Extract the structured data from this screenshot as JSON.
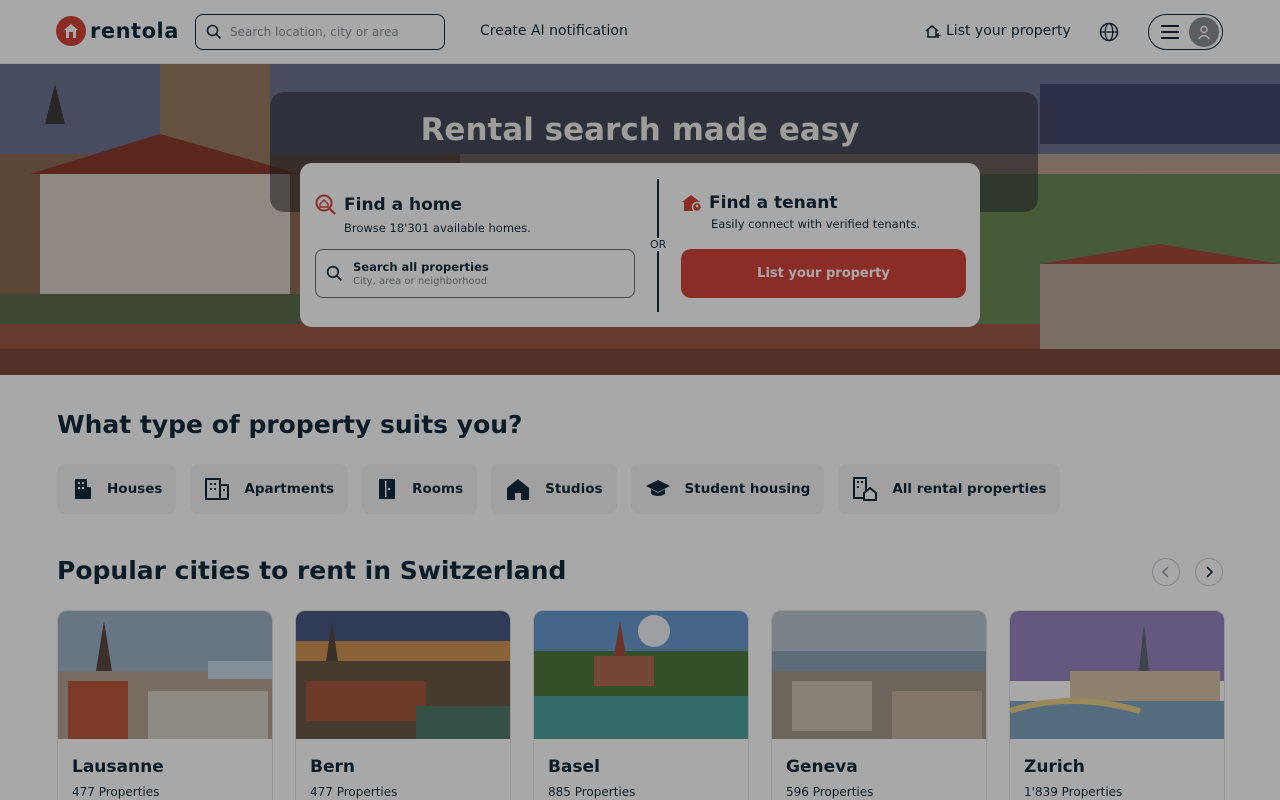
{
  "header": {
    "logo_text": "rentola",
    "search_placeholder": "Search location, city or area",
    "create_ai_label": "Create AI notification",
    "list_property_label": "List your property"
  },
  "hero": {
    "title": "Rental search made easy",
    "find_home": {
      "title": "Find a home",
      "subtitle": "Browse 18'301 available homes.",
      "search_title": "Search all properties",
      "search_subtitle": "City, area or neighborhood"
    },
    "or_label": "OR",
    "find_tenant": {
      "title": "Find a tenant",
      "subtitle": "Easily connect with verified tenants.",
      "button_label": "List your property"
    }
  },
  "property_types": {
    "title": "What type of property suits you?",
    "items": [
      {
        "label": "Houses",
        "icon": "building-icon"
      },
      {
        "label": "Apartments",
        "icon": "apartment-icon"
      },
      {
        "label": "Rooms",
        "icon": "door-icon"
      },
      {
        "label": "Studios",
        "icon": "home-icon"
      },
      {
        "label": "Student housing",
        "icon": "graduation-cap-icon"
      },
      {
        "label": "All rental properties",
        "icon": "buildings-home-icon"
      }
    ]
  },
  "cities": {
    "title": "Popular cities to rent in Switzerland",
    "items": [
      {
        "name": "Lausanne",
        "count": "477 Properties"
      },
      {
        "name": "Bern",
        "count": "477 Properties"
      },
      {
        "name": "Basel",
        "count": "885 Properties"
      },
      {
        "name": "Geneva",
        "count": "596 Properties"
      },
      {
        "name": "Zurich",
        "count": "1'839 Properties"
      }
    ]
  },
  "colors": {
    "brand": "#d4443b",
    "text": "#0e2a3a",
    "overlay": "rgba(0,0,0,0.34)"
  }
}
